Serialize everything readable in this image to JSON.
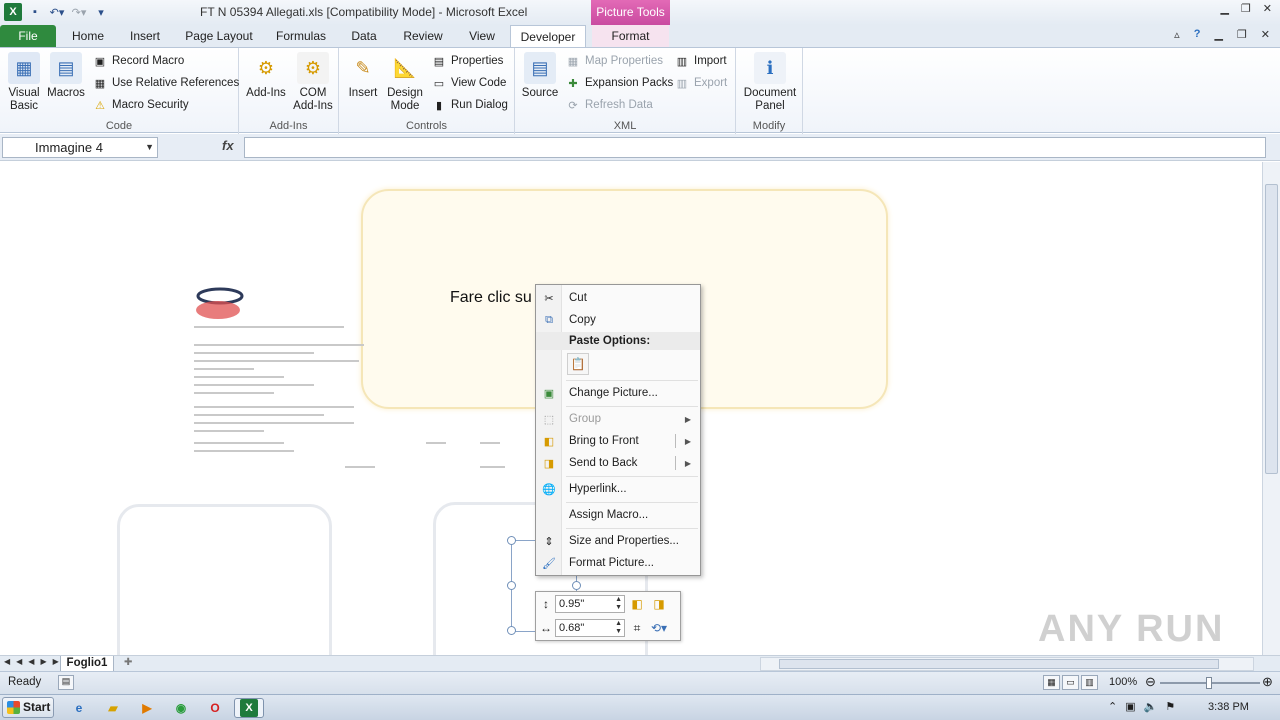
{
  "window": {
    "title": "FT N 05394 Allegati.xls  [Compatibility Mode]  -  Microsoft Excel",
    "contextual_tab": "Picture Tools"
  },
  "tabs": [
    "File",
    "Home",
    "Insert",
    "Page Layout",
    "Formulas",
    "Data",
    "Review",
    "View",
    "Developer",
    "Format"
  ],
  "active_tab": "Developer",
  "ribbon": {
    "code": {
      "label": "Code",
      "visual_basic": "Visual Basic",
      "macros": "Macros",
      "record_macro": "Record Macro",
      "use_relative": "Use Relative References",
      "macro_security": "Macro Security"
    },
    "addins": {
      "label": "Add-Ins",
      "addins": "Add-Ins",
      "com_addins": "COM Add-Ins"
    },
    "controls": {
      "label": "Controls",
      "insert": "Insert",
      "design_mode": "Design Mode",
      "properties": "Properties",
      "view_code": "View Code",
      "run_dialog": "Run Dialog"
    },
    "xml": {
      "label": "XML",
      "source": "Source",
      "map_properties": "Map Properties",
      "expansion_packs": "Expansion Packs",
      "refresh_data": "Refresh Data",
      "import": "Import",
      "export": "Export"
    },
    "modify": {
      "label": "Modify",
      "document_panel": "Document Panel"
    }
  },
  "formula_bar": {
    "name_box": "Immagine 4",
    "fx": "fx",
    "formula": ""
  },
  "sheet": {
    "placeholder_text": "Fare clic su                                         a contenuto"
  },
  "context_menu": {
    "cut": "Cut",
    "copy": "Copy",
    "paste_options": "Paste Options:",
    "change_picture": "Change Picture...",
    "group": "Group",
    "bring_to_front": "Bring to Front",
    "send_to_back": "Send to Back",
    "hyperlink": "Hyperlink...",
    "assign_macro": "Assign Macro...",
    "size_properties": "Size and Properties...",
    "format_picture": "Format Picture..."
  },
  "mini_toolbar": {
    "height": "0.95\"",
    "width": "0.68\""
  },
  "sheet_tabs": [
    "Foglio1"
  ],
  "status": {
    "ready": "Ready",
    "zoom": "100%"
  },
  "taskbar": {
    "start": "Start",
    "time": "3:38 PM"
  },
  "watermark": "ANY RUN",
  "colors": {
    "file_tab": "#2f8a3e",
    "picture_tools": "#d455a8",
    "placeholder_border": "#f5e6b8"
  }
}
